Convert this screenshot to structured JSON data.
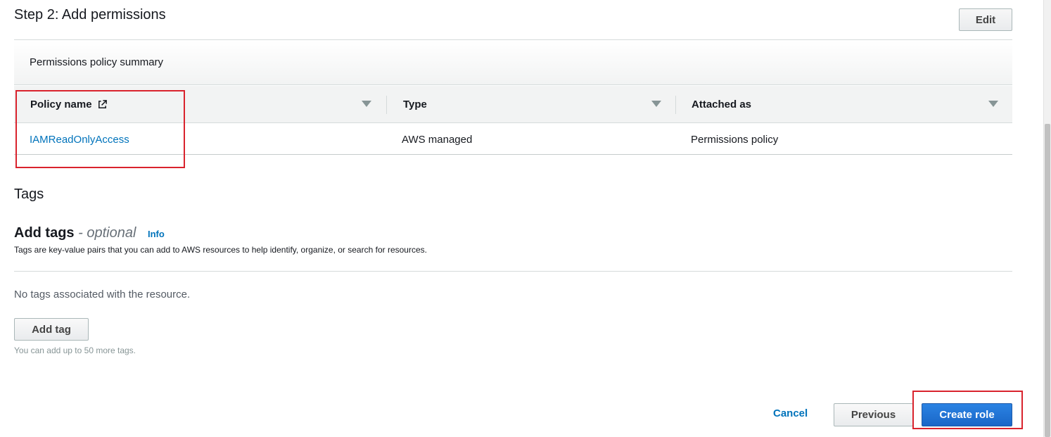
{
  "step": {
    "title": "Step 2: Add permissions",
    "edit_label": "Edit"
  },
  "permissions": {
    "summary_label": "Permissions policy summary",
    "columns": [
      "Policy name",
      "Type",
      "Attached as"
    ],
    "rows": [
      {
        "policy_name": "IAMReadOnlyAccess",
        "type": "AWS managed",
        "attached_as": "Permissions policy"
      }
    ]
  },
  "tags": {
    "section_title": "Tags",
    "add_title": "Add tags",
    "optional": "- optional",
    "info_label": "Info",
    "description": "Tags are key-value pairs that you can add to AWS resources to help identify, organize, or search for resources.",
    "empty_message": "No tags associated with the resource.",
    "add_tag_label": "Add tag",
    "limit_hint": "You can add up to 50 more tags."
  },
  "footer": {
    "cancel_label": "Cancel",
    "previous_label": "Previous",
    "create_label": "Create role"
  },
  "icons": {
    "column_sort": "caret-down-icon",
    "policy_name_link": "external-link-icon"
  },
  "colors": {
    "primary": "#1a66c7",
    "link": "#0073bb",
    "highlight": "#d9232d",
    "border": "#d5dbdb"
  }
}
